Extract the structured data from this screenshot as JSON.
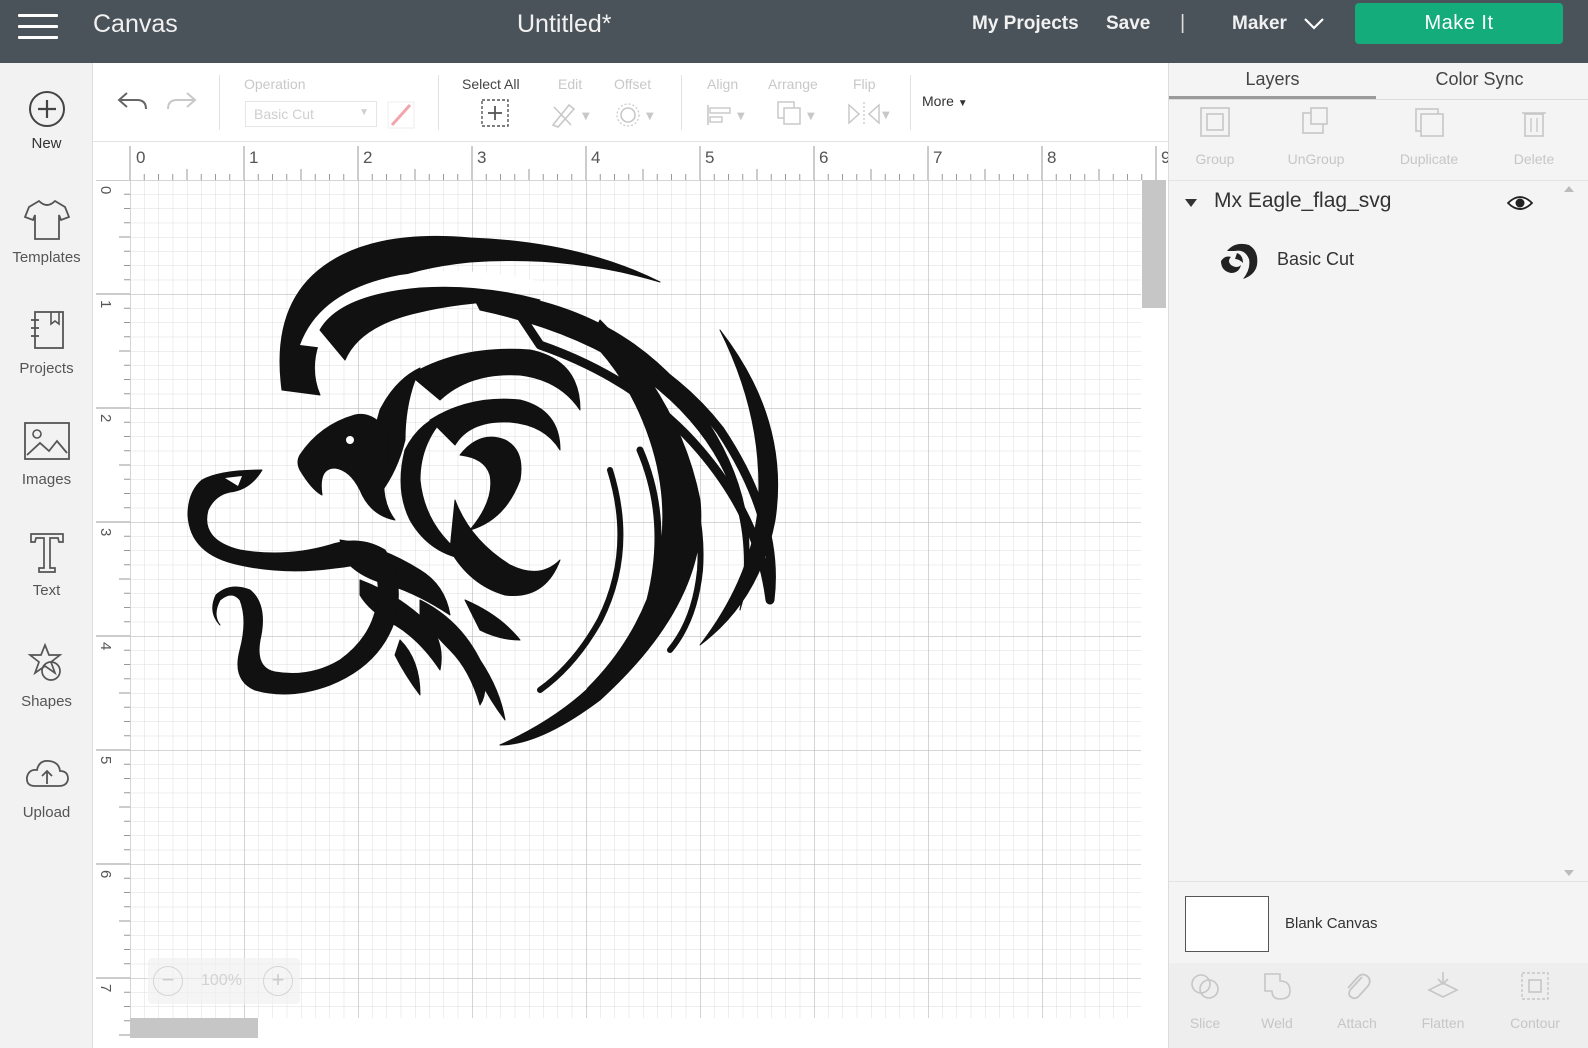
{
  "topbar": {
    "app_name": "Canvas",
    "doc_title": "Untitled*",
    "my_projects": "My Projects",
    "save": "Save",
    "separator": "|",
    "machine": "Maker",
    "make_it": "Make It",
    "make_it_color": "#13ac7a",
    "bar_color": "#4b535a"
  },
  "leftnav": [
    {
      "icon": "plus-circle-icon",
      "label": "New"
    },
    {
      "icon": "tshirt-icon",
      "label": "Templates"
    },
    {
      "icon": "projects-icon",
      "label": "Projects"
    },
    {
      "icon": "image-icon",
      "label": "Images"
    },
    {
      "icon": "text-icon",
      "label": "Text"
    },
    {
      "icon": "shapes-icon",
      "label": "Shapes"
    },
    {
      "icon": "upload-cloud-icon",
      "label": "Upload"
    }
  ],
  "toolbar": {
    "operation_label": "Operation",
    "operation_value": "Basic Cut",
    "select_all": "Select All",
    "edit": "Edit",
    "offset": "Offset",
    "align": "Align",
    "arrange": "Arrange",
    "flip": "Flip",
    "more": "More"
  },
  "ruler": {
    "top": [
      "0",
      "1",
      "2",
      "3",
      "4",
      "5",
      "6",
      "7",
      "8",
      "9"
    ],
    "left": [
      "0",
      "1",
      "2",
      "3",
      "4",
      "5",
      "6",
      "7"
    ]
  },
  "zoom": {
    "minus": "−",
    "value": "100%",
    "plus": "+"
  },
  "rightpanel": {
    "tabs": [
      "Layers",
      "Color Sync"
    ],
    "tools": [
      "Group",
      "UnGroup",
      "Duplicate",
      "Delete"
    ],
    "layer_name": "Mx Eagle_flag_svg",
    "layer_operation": "Basic Cut",
    "blank_canvas": "Blank Canvas",
    "bottom_tools": [
      "Slice",
      "Weld",
      "Attach",
      "Flatten",
      "Contour"
    ]
  }
}
